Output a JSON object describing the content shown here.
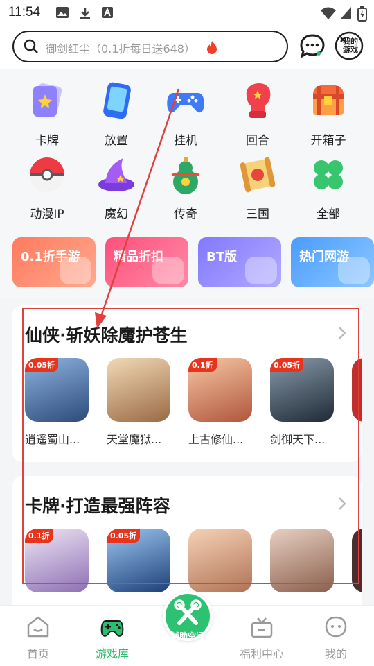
{
  "status_bar": {
    "time": "11:54"
  },
  "search": {
    "placeholder": "御剑红尘（0.1折每日送648）"
  },
  "header": {
    "my_games_label": "我的游戏"
  },
  "categories": [
    {
      "label": "卡牌",
      "icon": "card-icon"
    },
    {
      "label": "放置",
      "icon": "phone-icon"
    },
    {
      "label": "挂机",
      "icon": "gamepad-icon"
    },
    {
      "label": "回合",
      "icon": "boxing-glove-icon"
    },
    {
      "label": "开箱子",
      "icon": "treasure-chest-icon"
    },
    {
      "label": "动漫IP",
      "icon": "pokeball-icon"
    },
    {
      "label": "魔幻",
      "icon": "wizard-hat-icon"
    },
    {
      "label": "传奇",
      "icon": "gourd-icon"
    },
    {
      "label": "三国",
      "icon": "scroll-icon"
    },
    {
      "label": "全部",
      "icon": "clover-icon"
    }
  ],
  "tags": [
    {
      "label": "0.1折手游",
      "color": "#ff8a6b"
    },
    {
      "label": "精品折扣",
      "color": "#ff5f87"
    },
    {
      "label": "BT版",
      "color": "#8f86ff"
    },
    {
      "label": "热门网游",
      "color": "#5aa9ff"
    }
  ],
  "sections": [
    {
      "title": "仙侠·斩妖除魔护苍生",
      "games": [
        {
          "name": "逍遥蜀山...",
          "badge": "0.05折",
          "color": "#4a6fa5"
        },
        {
          "name": "天堂魔狱...",
          "badge": "",
          "color": "#c9a47a"
        },
        {
          "name": "上古修仙...",
          "badge": "0.1折",
          "color": "#d88a6a"
        },
        {
          "name": "剑御天下...",
          "badge": "0.05折",
          "color": "#3a4a5c"
        }
      ]
    },
    {
      "title": "卡牌·打造最强阵容",
      "games": [
        {
          "name": "",
          "badge": "0.1折",
          "color": "#c7b3d9"
        },
        {
          "name": "",
          "badge": "0.05折",
          "color": "#3d6ea8"
        },
        {
          "name": "",
          "badge": "",
          "color": "#d9a07f"
        },
        {
          "name": "",
          "badge": "",
          "color": "#b38a7a"
        }
      ]
    }
  ],
  "tabbar": {
    "home": "首页",
    "library": "游戏库",
    "assist": "辅助空间",
    "welfare": "福利中心",
    "mine": "我的"
  },
  "colors": {
    "accent": "#2dbd6e",
    "annotation": "#e0403e"
  }
}
